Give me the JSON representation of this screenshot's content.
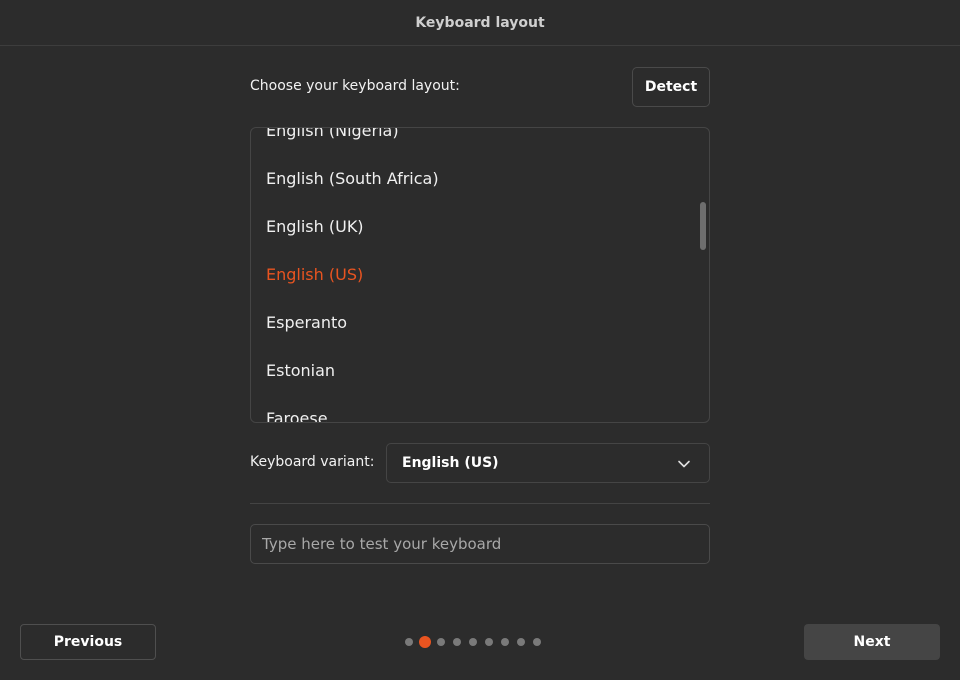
{
  "window": {
    "title": "Keyboard layout"
  },
  "layout": {
    "label": "Choose your keyboard layout:",
    "detect_label": "Detect",
    "items": [
      "English (Nigeria)",
      "English (South Africa)",
      "English (UK)",
      "English (US)",
      "Esperanto",
      "Estonian",
      "Faroese"
    ],
    "selected": "English (US)"
  },
  "variant": {
    "label": "Keyboard variant:",
    "value": "English (US)",
    "chevron_icon": "chevron-down-icon"
  },
  "test_input": {
    "placeholder": "Type here to test your keyboard",
    "value": ""
  },
  "nav": {
    "previous_label": "Previous",
    "next_label": "Next",
    "total_steps": 9,
    "current_step": 2
  },
  "colors": {
    "accent": "#e95420",
    "background": "#2c2c2c"
  }
}
